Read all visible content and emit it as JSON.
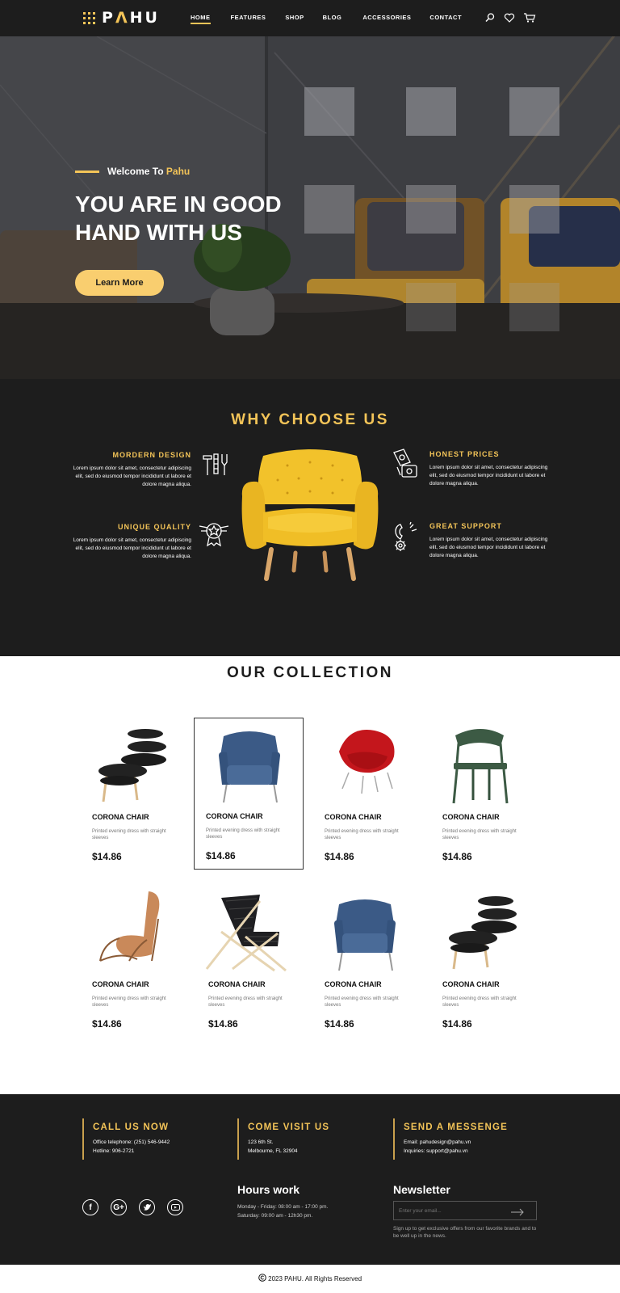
{
  "brand": {
    "name_pre": "P",
    "name_a": "Λ",
    "name_post": "HU"
  },
  "nav": {
    "items": [
      "HOME",
      "FEATURES",
      "SHOP",
      "BLOG",
      "ACCESSORIES",
      "CONTACT"
    ],
    "active": "HOME"
  },
  "header_icons": [
    "search-icon",
    "heart-icon",
    "cart-icon"
  ],
  "hero": {
    "welcome_prefix": "Welcome To ",
    "welcome_brand": "Pahu",
    "title_line1": "YOU ARE IN GOOD",
    "title_line2": "HAND WITH US",
    "button": "Learn More"
  },
  "why": {
    "title": "WHY CHOOSE US",
    "features": [
      {
        "title": "MORDERN DESIGN",
        "text": "Lorem ipsum dolor sit amet, consectetur adipiscing elit, sed do eiusmod tempor incididunt ut labore et dolore magna aliqua.",
        "icon": "tools-icon"
      },
      {
        "title": "UNIQUE QUALITY",
        "text": "Lorem ipsum dolor sit amet, consectetur adipiscing elit, sed do eiusmod tempor incididunt ut labore et dolore magna aliqua.",
        "icon": "award-icon"
      },
      {
        "title": "HONEST PRICES",
        "text": "Lorem ipsum dolor sit amet, consectetur adipiscing elit, sed do eiusmod tempor incididunt ut labore et dolore magna aliqua.",
        "icon": "money-icon"
      },
      {
        "title": "GREAT SUPPORT",
        "text": "Lorem ipsum dolor sit amet, consectetur adipiscing elit, sed do eiusmod tempor incididunt ut labore et dolore magna aliqua.",
        "icon": "support-icon"
      }
    ]
  },
  "collection": {
    "title": "OUR COLLECTION",
    "products": [
      {
        "name": "CORONA CHAIR",
        "desc": "Printed evening dress with straight sleeves",
        "price": "$14.86"
      },
      {
        "name": "CORONA CHAIR",
        "desc": "Printed evening dress with straight sleeves",
        "price": "$14.86"
      },
      {
        "name": "CORONA CHAIR",
        "desc": "Printed evening dress with straight sleeves",
        "price": "$14.86"
      },
      {
        "name": "CORONA CHAIR",
        "desc": "Printed evening dress with straight sleeves",
        "price": "$14.86"
      },
      {
        "name": "CORONA CHAIR",
        "desc": "Printed evening dress with straight sleeves",
        "price": "$14.86"
      },
      {
        "name": "CORONA CHAIR",
        "desc": "Printed evening dress with straight sleeves",
        "price": "$14.86"
      },
      {
        "name": "CORONA CHAIR",
        "desc": "Printed evening dress with straight sleeves",
        "price": "$14.86"
      },
      {
        "name": "CORONA CHAIR",
        "desc": "Printed evening dress with straight sleeves",
        "price": "$14.86"
      }
    ]
  },
  "footer": {
    "call": {
      "title": "CALL US NOW",
      "line1": "Office telephone: (251) 546-9442",
      "line2": "Hotline: 906-2721"
    },
    "visit": {
      "title": "COME VISIT US",
      "line1": "123 6th St.",
      "line2": "Melbourne, FL 32904"
    },
    "message": {
      "title": "SEND A MESSENGE",
      "line1": "Email: pahudesign@pahu.vn",
      "line2": "Inquiries: support@pahu.vn"
    },
    "socials": [
      "facebook-icon",
      "google-plus-icon",
      "twitter-icon",
      "youtube-icon"
    ],
    "hours": {
      "title": "Hours work",
      "line1": "Monday - Friday: 08:00 am - 17:00 pm.",
      "line2": "Saturday: 09:00 am - 12h30 pm."
    },
    "newsletter": {
      "title": "Newsletter",
      "placeholder": "Enter your email...",
      "text": "Sign up to get exclusive offers from our favorite brands and to be well up in the news."
    }
  },
  "copyright": "2023 PAHU. All Rights Reserved",
  "colors": {
    "accent": "#f3c458",
    "dark": "#1d1d1d",
    "button": "#f9ce6f"
  }
}
